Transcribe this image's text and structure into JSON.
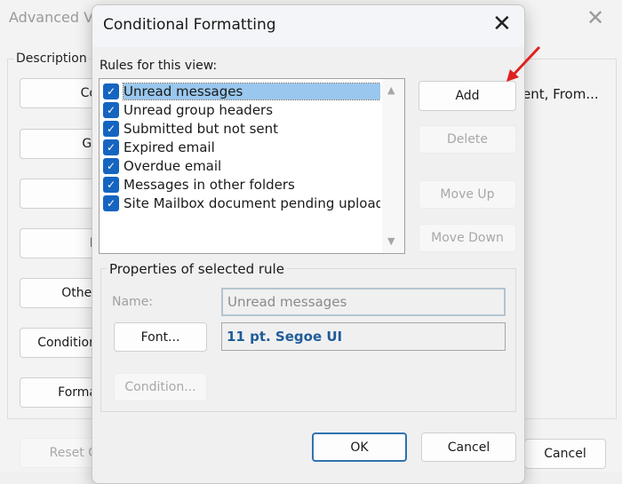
{
  "background_window": {
    "title": "Advanced V",
    "group_label": "Description",
    "buttons": [
      "Co",
      "Gr",
      "",
      "F",
      "Other",
      "Condition",
      "Forma"
    ],
    "side_text": "ent, From...",
    "reset_label": "Reset C",
    "cancel_label": "Cancel"
  },
  "dialog": {
    "title": "Conditional Formatting",
    "rules_label": "Rules for this view:",
    "rules": [
      {
        "label": "Unread messages",
        "checked": true,
        "selected": true
      },
      {
        "label": "Unread group headers",
        "checked": true
      },
      {
        "label": "Submitted but not sent",
        "checked": true
      },
      {
        "label": "Expired email",
        "checked": true
      },
      {
        "label": "Overdue email",
        "checked": true
      },
      {
        "label": "Messages in other folders",
        "checked": true
      },
      {
        "label": "Site Mailbox document pending upload",
        "checked": true
      }
    ],
    "buttons": {
      "add": "Add",
      "delete": "Delete",
      "move_up": "Move Up",
      "move_down": "Move Down",
      "ok": "OK",
      "cancel": "Cancel"
    },
    "properties": {
      "group_label": "Properties of selected rule",
      "name_label": "Name:",
      "name_value": "Unread messages",
      "font_button": "Font...",
      "font_value": "11 pt. Segoe UI",
      "condition_button": "Condition..."
    }
  },
  "colors": {
    "checkbox": "#1565c0",
    "selection": "#99c7ee",
    "font_value": "#1f5c99",
    "annotation_arrow": "#e02020"
  }
}
